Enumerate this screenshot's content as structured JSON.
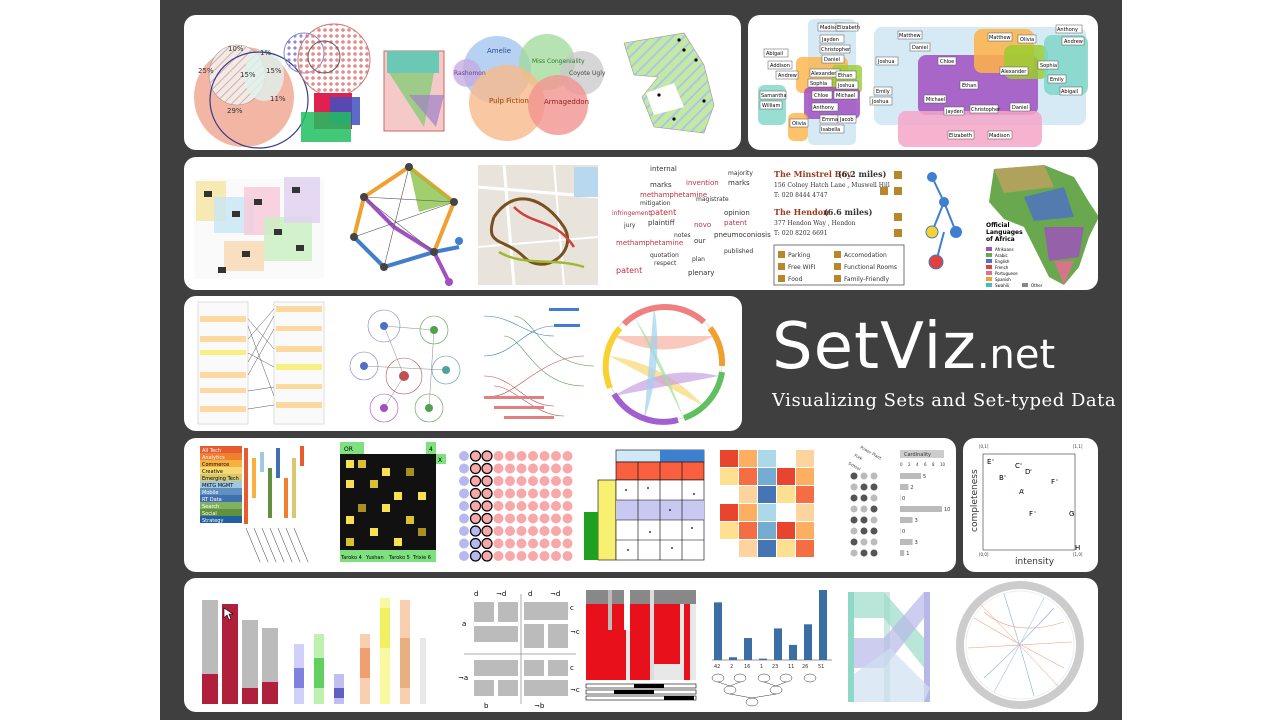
{
  "brand": {
    "name_main": "SetViz",
    "name_suffix": ".net",
    "tagline": "Visualizing Sets and Set-typed Data"
  },
  "euler": {
    "pct_10": "10%",
    "pct_1": "1%",
    "pct_25": "25%",
    "pct_15a": "15%",
    "pct_15b": "15%",
    "pct_11": "11%",
    "pct_29": "29%"
  },
  "bubble_sets": {
    "labels": [
      "Amelie",
      "Miss Congeniality",
      "Rashomon",
      "Coyote Ugly",
      "Pulp Fiction",
      "Armageddon"
    ]
  },
  "names_left": [
    "Madison",
    "Elizabeth",
    "Jayden",
    "Christopher",
    "Daniel",
    "Abigail",
    "Addison",
    "Andrew",
    "Alexander",
    "Ethan",
    "Sophia",
    "Joshua",
    "Chloe",
    "Samantha",
    "Michael",
    "William",
    "Anthony",
    "Emily",
    "Joshua",
    "Olivia",
    "Emma",
    "Isabella",
    "Jacob"
  ],
  "names_right": [
    "Matthew",
    "Daniel",
    "Matthew",
    "Olivia",
    "Anthony",
    "Andrew",
    "Joshua",
    "Chloe",
    "Alexander",
    "Sophia",
    "Michael",
    "Jayden",
    "Christopher",
    "Daniel",
    "Elizabeth",
    "Madison",
    "Ethan",
    "Emily",
    "Abigail"
  ],
  "word_cloud": {
    "words": [
      "internal",
      "marks",
      "invention",
      "methamphetamine",
      "mitigation",
      "patent",
      "plaintiff",
      "infringement",
      "invention",
      "methamphetamine",
      "patent",
      "quotation",
      "jury",
      "respect",
      "novo",
      "our",
      "plan",
      "plenary",
      "opinion",
      "patent",
      "pneumoconiosis",
      "published",
      "majority",
      "marks",
      "magistrate",
      "notes"
    ]
  },
  "pubs": {
    "pub1_name": "The Minstrel Boy",
    "pub1_dist": "(6.2 miles)",
    "pub1_addr": "156 Colney Hatch Lane , Muswell Hill",
    "pub1_tel": "T: 020 8444 4747",
    "pub2_name": "The Hendon",
    "pub2_dist": "(6.6 miles)",
    "pub2_addr": "377 Hendon Way , Hendon",
    "pub2_tel": "T: 020 8202 6691",
    "legend": [
      "Parking",
      "Accomodation",
      "Free WIFI",
      "Functional Rooms",
      "Food",
      "Family-Friendly"
    ]
  },
  "africa": {
    "title_line1": "Official",
    "title_line2": "Languages",
    "title_line3": "of Africa",
    "languages": [
      "Afrikaans",
      "Arabic",
      "English",
      "French",
      "Portuguese",
      "Spanish",
      "Swahili",
      "Other"
    ]
  },
  "upset_left": {
    "rows": [
      "All Tech",
      "Analytics",
      "Commerce",
      "Creative",
      "Emerging Tech",
      "MKTG MGMT",
      "Mobile",
      "RT Data",
      "Search",
      "Social",
      "Strategy"
    ]
  },
  "matrix_header": {
    "or_label": "OR",
    "count": "4",
    "x_label": "X",
    "cols": [
      "Taroko 4",
      "Yushan",
      "Taroko 5",
      "Trixie 6"
    ]
  },
  "radset": {
    "title": "Cardinality",
    "values": [
      "5",
      "2",
      "0",
      "10",
      "3",
      "0",
      "3",
      "1"
    ],
    "axis": [
      "0",
      "2",
      "4",
      "6",
      "8",
      "10"
    ],
    "sets": [
      "Power Plant",
      "Fork",
      "School"
    ]
  },
  "scatter": {
    "x_label": "intensity",
    "y_label": "completeness",
    "corner_tl": "[0,1]",
    "corner_tr": "[1,1]",
    "corner_bl": "[0,0]",
    "corner_br": "[1,0]",
    "points": [
      "E",
      "C",
      "B",
      "D",
      "A",
      "F",
      "F",
      "G",
      "H"
    ]
  },
  "cells_labels": {
    "d1": "d",
    "nd1": "¬d",
    "d2": "d",
    "nd2": "¬d",
    "a": "a",
    "na": "¬a",
    "c1": "c",
    "nc1": "¬c",
    "c2": "c",
    "nc2": "¬c",
    "b": "b",
    "nb": "¬b"
  },
  "tree_bars": {
    "values": [
      "42",
      "2",
      "16",
      "1",
      "23",
      "11",
      "26",
      "51"
    ]
  }
}
